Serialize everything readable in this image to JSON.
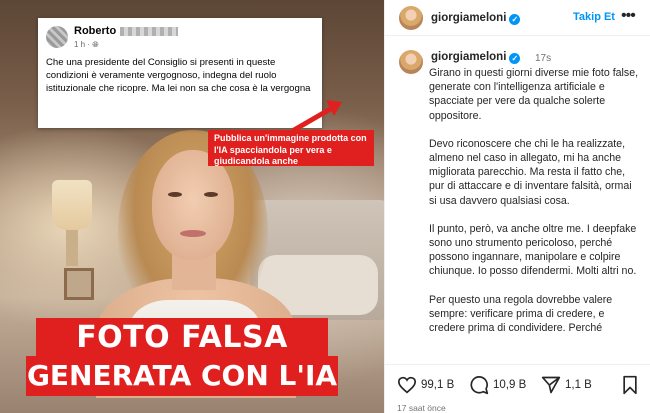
{
  "post": {
    "fb_card": {
      "author": "Roberto",
      "time": "1 h ·",
      "text": "Che una presidente del Consiglio  si presenti in queste condizioni è veramente vergognoso, indegna del ruolo istituzionale che ricopre. Ma lei non sa che cosa è la vergogna"
    },
    "callout": "Pubblica un'immagine prodotta con l'IA spacciandola per vera e giudicandola anche",
    "banner_line1": "FOTO FALSA",
    "banner_line2": "GENERATA CON L'IA"
  },
  "header": {
    "username": "giorgiameloni",
    "verified_mark": "✓",
    "follow_label": "Takip Et",
    "more_label": "•••"
  },
  "comment": {
    "username": "giorgiameloni",
    "ago": "17s",
    "paragraphs": [
      "Girano in questi giorni diverse mie foto false, generate con l'intelligenza artificiale e spacciate per vere da qualche solerte oppositore.",
      "Devo riconoscere che chi le ha realizzate, almeno nel caso in allegato, mi ha anche migliorata parecchio. Ma resta il fatto che, pur di attaccare e di inventare falsità, ormai si usa davvero qualsiasi cosa.",
      "Il punto, però, va anche oltre me. I deepfake sono uno strumento pericoloso, perché possono ingannare, manipolare e colpire chiunque. Io posso difendermi. Molti altri no.",
      "Per questo una regola dovrebbe valere sempre: verificare prima di credere, e credere prima di condividere. Perché"
    ]
  },
  "actions": {
    "likes": "99,1 B",
    "comments": "10,9 B",
    "shares": "1,1 B",
    "icons": [
      "heart-icon",
      "comment-icon",
      "share-icon",
      "bookmark-icon"
    ]
  },
  "timestamp": "17 saat önce",
  "colors": {
    "accent_red": "#e0201f",
    "link_blue": "#0095f6"
  }
}
